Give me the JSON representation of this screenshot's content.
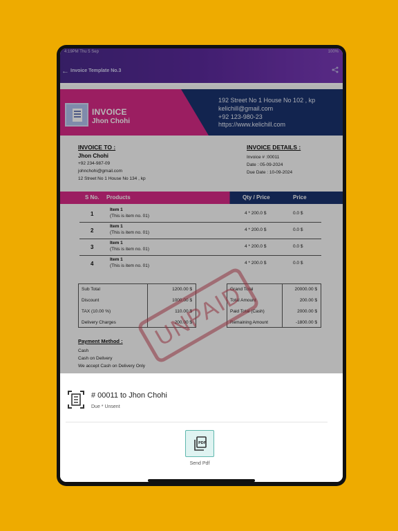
{
  "status_bar": {
    "time": "4:19PM   Thu 5 Sep",
    "battery": "100%"
  },
  "app_bar": {
    "title": "Invoice Template No.3"
  },
  "invoice": {
    "header": {
      "title": "INVOICE",
      "name": "Jhon Chohi",
      "address": "192 Street No 1 House No 102 , kp",
      "email": "kelichill@gmail.com",
      "phone": "+92 123-980-23",
      "website": "https://www.kelichill.com"
    },
    "invoice_to": {
      "label": "INVOICE TO :",
      "name": "Jhon Chohi",
      "phone": "+92 234-987-09",
      "email": "johnchohi@gmail.com",
      "address": "12 Street No 1 House No 134 , kp"
    },
    "invoice_details": {
      "label": "INVOICE DETAILS :",
      "number": "Invoice # :00011",
      "date": "Date : 05-09-2024",
      "due_date": "Due Date : 10-09-2024"
    },
    "table": {
      "headers": {
        "sno": "S No.",
        "products": "Products",
        "qty": "Qty / Price",
        "price": "Price"
      },
      "rows": [
        {
          "no": "1",
          "name": "Item 1",
          "desc": "(This is item no. 01)",
          "qty": "4 * 200.0  $",
          "price": "0.0  $"
        },
        {
          "no": "2",
          "name": "Item 1",
          "desc": "(This is item no. 01)",
          "qty": "4 * 200.0  $",
          "price": "0.0  $"
        },
        {
          "no": "3",
          "name": "Item 1",
          "desc": "(This is item no. 01)",
          "qty": "4 * 200.0  $",
          "price": "0.0  $"
        },
        {
          "no": "4",
          "name": "Item 1",
          "desc": "(This is item no. 01)",
          "qty": "4 * 200.0  $",
          "price": "0.0  $"
        }
      ]
    },
    "totals_left": [
      {
        "label": "Sub Total",
        "value": "1200.00  $"
      },
      {
        "label": "Discount",
        "value": "1000.00  $"
      },
      {
        "label": "TAX (10.00 %)",
        "value": "110.00  $"
      },
      {
        "label": "Delivery Charges",
        "value": "200.00  $"
      }
    ],
    "totals_right": [
      {
        "label": "Grand Total",
        "value": "20000.00  $"
      },
      {
        "label": "Total Amount",
        "value": "200.00  $"
      },
      {
        "label": "Paid Total (Cash)",
        "value": "2000.00  $"
      },
      {
        "label": "Remaining Amount",
        "value": "-1800.00  $"
      }
    ],
    "stamp": "UNPAID",
    "payment": {
      "label": "Payment Method :",
      "method": "Cash",
      "detail": "Cash on Delivery",
      "note": "We accept Cash on Delivery Only"
    }
  },
  "sheet": {
    "title": "# 00011 to Jhon Chohi",
    "subtitle": "Due * Unsent",
    "pdf_label": "Send Pdf"
  },
  "icons": {
    "back": "arrow-left-icon",
    "share": "share-icon",
    "document": "document-scan-icon",
    "pdf": "pdf-file-icon"
  },
  "colors": {
    "background": "#eeab00",
    "brand_magenta": "#d72a87",
    "brand_navy": "#19336e",
    "appbar_purple": "#5b2a9c",
    "stamp_red": "#c8485a",
    "pdf_button_teal": "#5fb7ad"
  }
}
